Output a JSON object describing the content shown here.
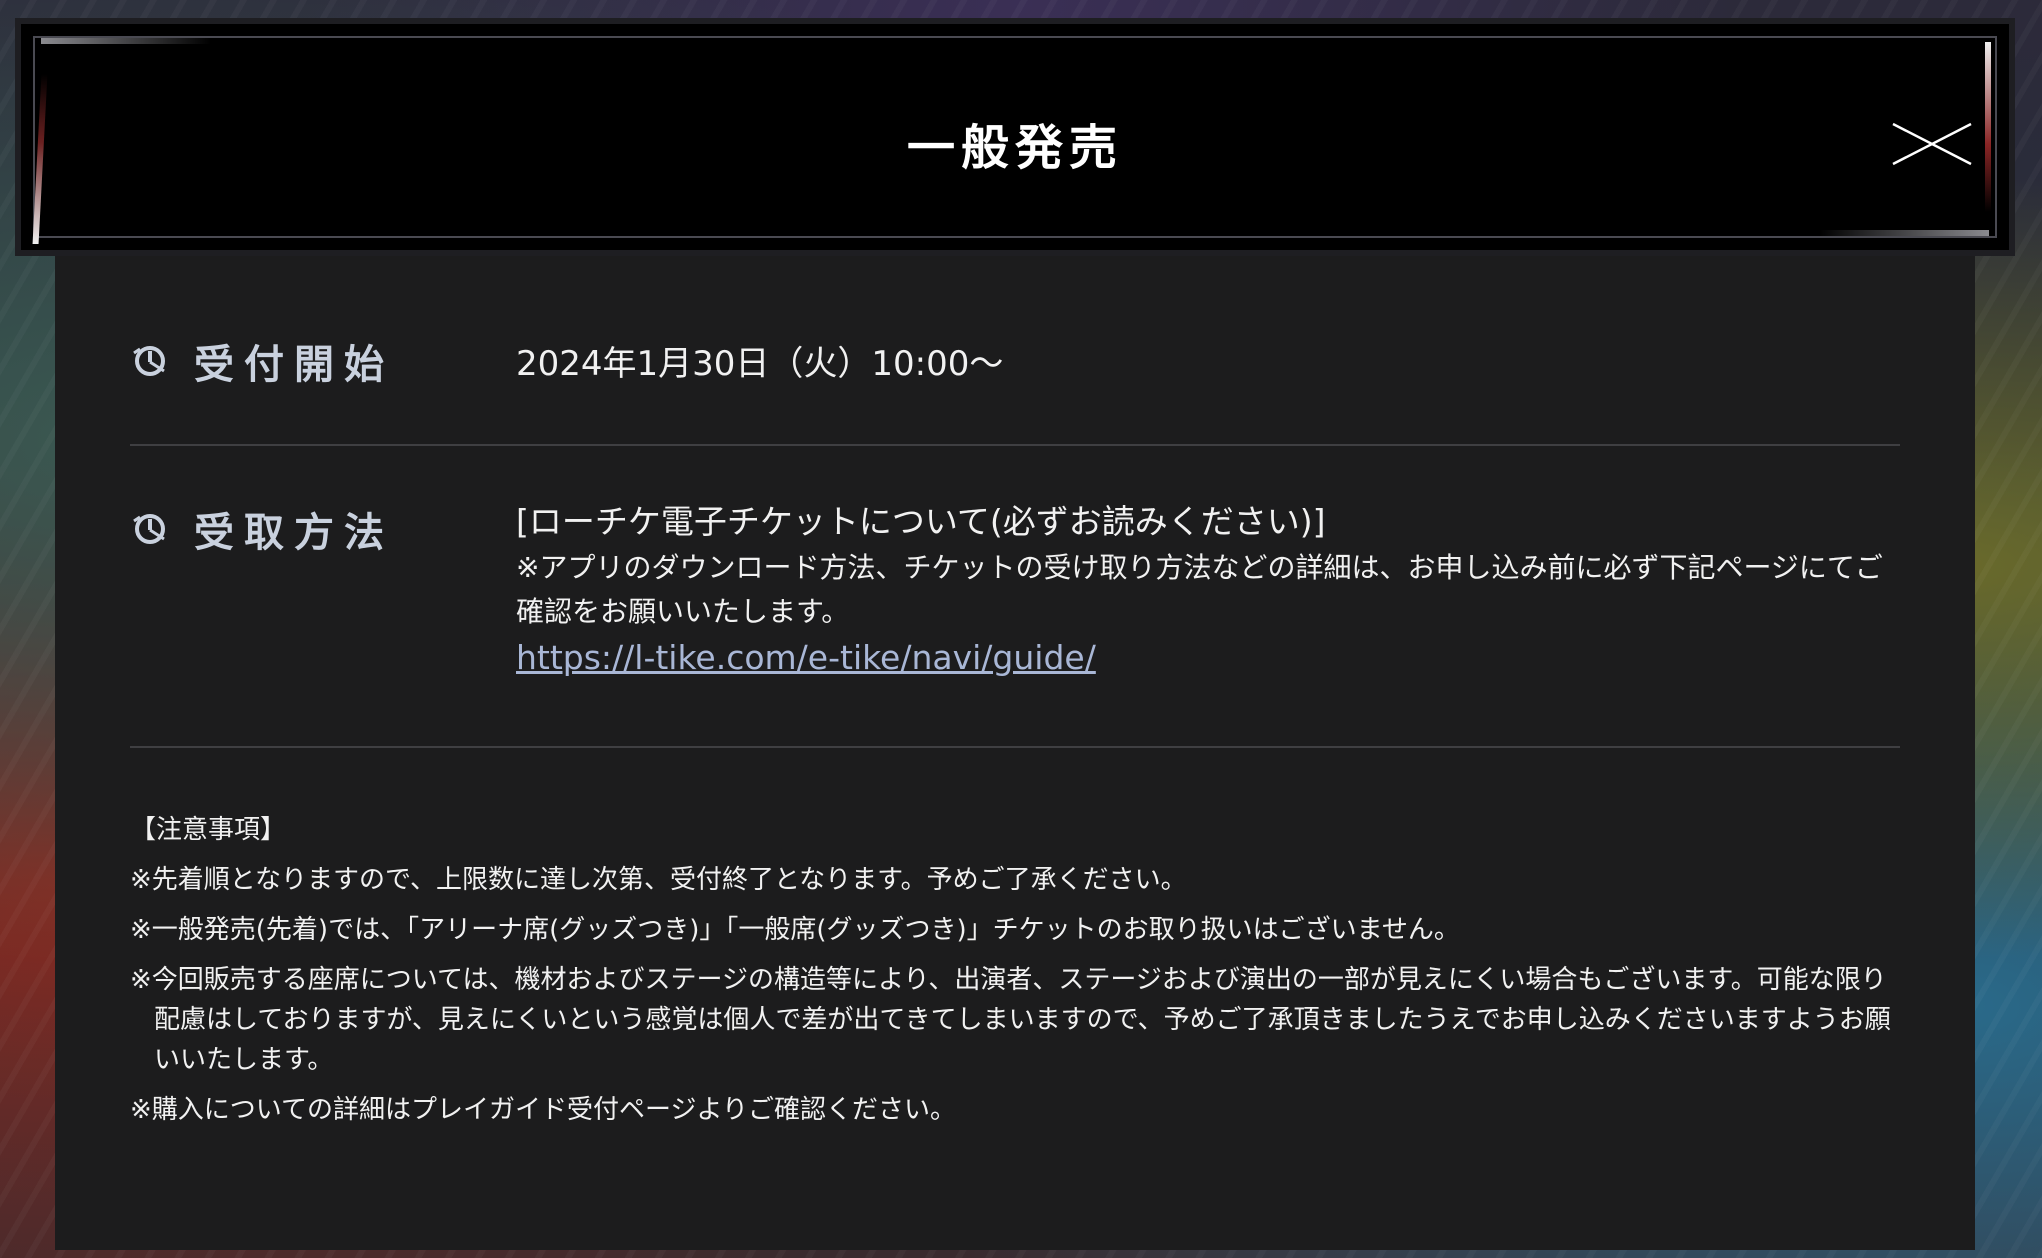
{
  "header": {
    "title": "一般発売"
  },
  "rows": {
    "start": {
      "label": "受付開始",
      "value": "2024年1月30日（火）10:00〜"
    },
    "receive": {
      "label": "受取方法",
      "heading": "[ローチケ電子チケットについて(必ずお読みください)]",
      "note": "※アプリのダウンロード方法、チケットの受け取り方法などの詳細は、お申し込み前に必ず下記ページにてご確認をお願いいたします。",
      "link": "https://l-tike.com/e-tike/navi/guide/"
    }
  },
  "notices": {
    "heading": "【注意事項】",
    "items": [
      "※先着順となりますので、上限数に達し次第、受付終了となります。予めご了承ください。",
      "※一般発売(先着)では、「アリーナ席(グッズつき)」「一般席(グッズつき)」チケットのお取り扱いはございません。",
      "※今回販売する座席については、機材およびステージの構造等により、出演者、ステージおよび演出の一部が見えにくい場合もございます。可能な限り配慮はしておりますが、見えにくいという感覚は個人で差が出てきてしまいますので、予めご了承頂きましたうえでお申し込みくださいますようお願いいたします。",
      "※購入についての詳細はプレイガイド受付ページよりご確認ください。"
    ]
  },
  "colors": {
    "panel": "#1c1c1d",
    "header": "#000000",
    "label": "#c9d1de",
    "link": "#a9b7d6",
    "divider": "#3f3f42"
  },
  "icons": {
    "row_icon": "clock-icon",
    "close": "close-icon"
  }
}
